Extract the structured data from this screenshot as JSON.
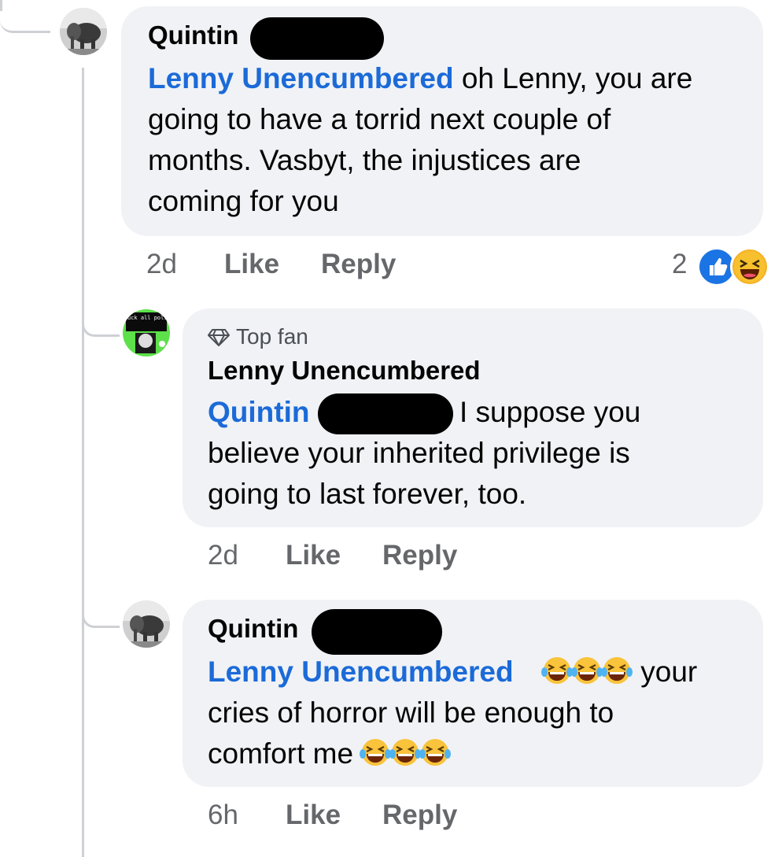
{
  "comments": [
    {
      "author": "Quintin",
      "lines": [
        {
          "mention": "Lenny Unencumbered",
          "text": " oh Lenny, you are"
        },
        {
          "text": "going to have a torrid next couple of"
        },
        {
          "text": "months. Vasbyt, the injustices are"
        },
        {
          "text": "coming for you"
        }
      ],
      "time": "2d",
      "like": "Like",
      "reply": "Reply",
      "reaction_count": "2"
    },
    {
      "badge": "Top fan",
      "author": "Lenny Unencumbered",
      "mention": "Quintin",
      "lines": [
        {
          "text": "I suppose you"
        },
        {
          "text": "believe your inherited privilege is"
        },
        {
          "text": "going to last forever, too."
        }
      ],
      "avatar_text": "uck all politicians",
      "time": "2d",
      "like": "Like",
      "reply": "Reply"
    },
    {
      "author": "Quintin",
      "mention": "Lenny Unencumbered",
      "lines": [
        {
          "text": " your"
        },
        {
          "text": "cries of horror will be enough to"
        },
        {
          "text": "comfort me "
        }
      ],
      "time": "6h",
      "like": "Like",
      "reply": "Reply"
    }
  ],
  "icons": {
    "like_reaction": "thumbs-up-icon",
    "haha_reaction": "laughing-face-icon",
    "tears_emoji": "tears-of-joy-emoji",
    "top_fan": "diamond-icon"
  },
  "colors": {
    "mention": "#1b6ad8",
    "bubble": "#f0f2f5",
    "meta": "#65676b"
  }
}
